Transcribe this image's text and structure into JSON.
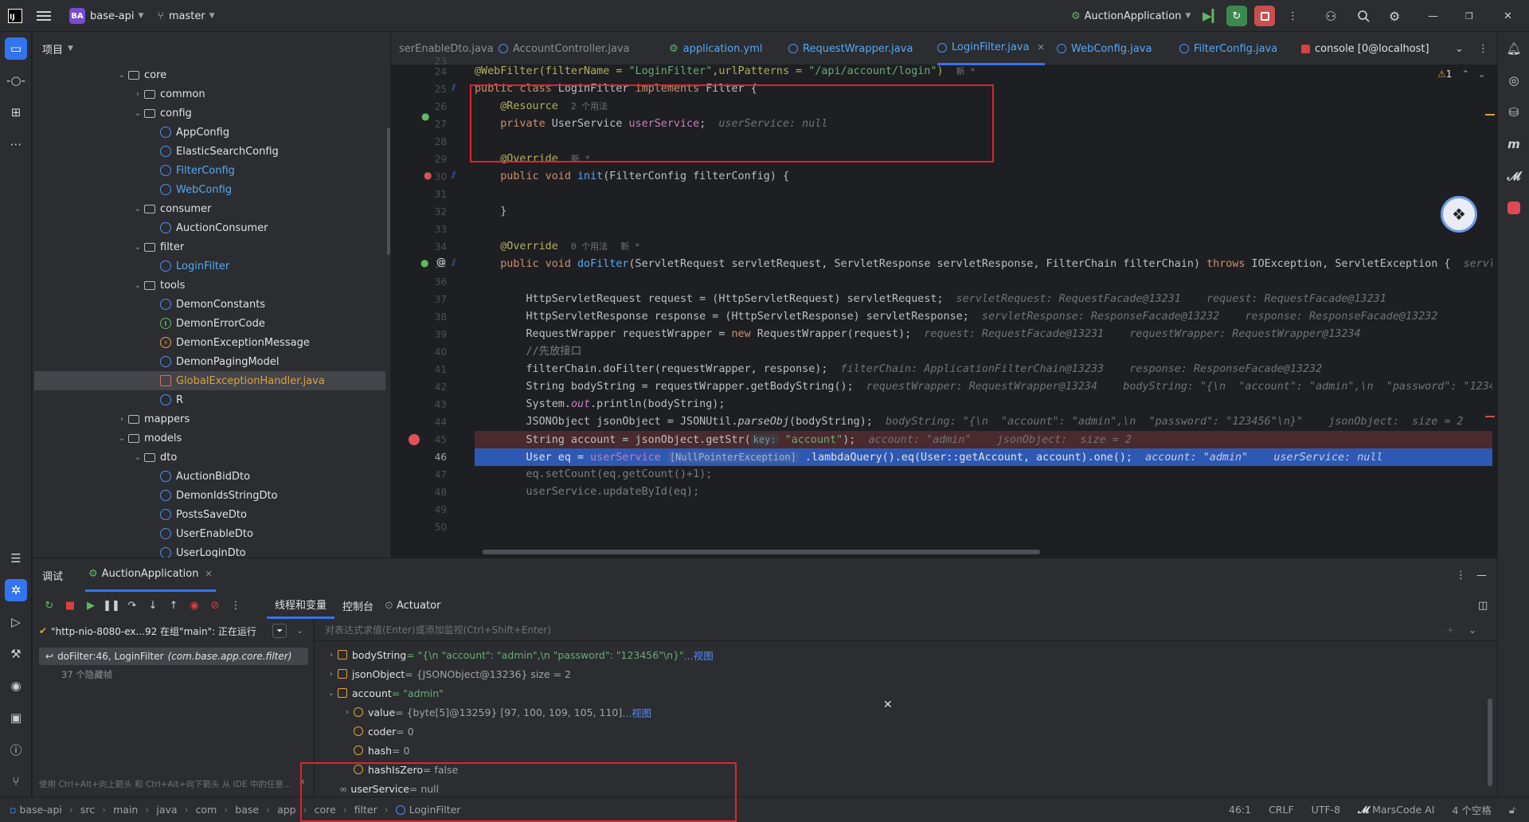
{
  "titlebar": {
    "project_badge": "BA",
    "project_name": "base-api",
    "branch": "master",
    "run_config": "AuctionApplication"
  },
  "project_panel": {
    "title": "项目",
    "tree": [
      {
        "label": "core",
        "type": "folder",
        "expanded": true
      },
      {
        "label": "common",
        "type": "folder",
        "expanded": false
      },
      {
        "label": "config",
        "type": "folder",
        "expanded": true
      },
      {
        "label": "AppConfig",
        "type": "class"
      },
      {
        "label": "ElasticSearchConfig",
        "type": "class"
      },
      {
        "label": "FilterConfig",
        "type": "class",
        "color": "#56a8f5"
      },
      {
        "label": "WebConfig",
        "type": "class",
        "color": "#56a8f5"
      },
      {
        "label": "consumer",
        "type": "folder",
        "expanded": true
      },
      {
        "label": "AuctionConsumer",
        "type": "class"
      },
      {
        "label": "filter",
        "type": "folder",
        "expanded": true
      },
      {
        "label": "LoginFilter",
        "type": "class",
        "color": "#56a8f5"
      },
      {
        "label": "tools",
        "type": "folder",
        "expanded": true
      },
      {
        "label": "DemonConstants",
        "type": "class"
      },
      {
        "label": "DemonErrorCode",
        "type": "interface"
      },
      {
        "label": "DemonExceptionMessage",
        "type": "exception"
      },
      {
        "label": "DemonPagingModel",
        "type": "class"
      },
      {
        "label": "GlobalExceptionHandler.java",
        "type": "javafile",
        "color": "#d9a343"
      },
      {
        "label": "R",
        "type": "class"
      },
      {
        "label": "mappers",
        "type": "folder",
        "expanded": false
      },
      {
        "label": "models",
        "type": "folder",
        "expanded": true
      },
      {
        "label": "dto",
        "type": "folder",
        "expanded": true
      },
      {
        "label": "AuctionBidDto",
        "type": "class"
      },
      {
        "label": "DemonIdsStringDto",
        "type": "class"
      },
      {
        "label": "PostsSaveDto",
        "type": "class"
      },
      {
        "label": "UserEnableDto",
        "type": "class"
      },
      {
        "label": "UserLoginDto",
        "type": "class"
      }
    ]
  },
  "editor_tabs": [
    {
      "label": "serEnableDto.java"
    },
    {
      "label": "AccountController.java"
    },
    {
      "label": "application.yml"
    },
    {
      "label": "RequestWrapper.java"
    },
    {
      "label": "LoginFilter.java",
      "active": true
    },
    {
      "label": "WebConfig.java"
    },
    {
      "label": "FilterConfig.java"
    },
    {
      "label": "console [0@localhost]"
    }
  ],
  "editor": {
    "warning_count": "1",
    "line_numbers": [
      "23",
      "24",
      "25",
      "26",
      "27",
      "28",
      "29",
      "30",
      "31",
      "32",
      "33",
      "34",
      "35",
      "36",
      "37",
      "38",
      "39",
      "40",
      "41",
      "42",
      "43",
      "44",
      "45",
      "46",
      "47",
      "48",
      "49",
      "50"
    ],
    "current_line": "46",
    "breakpoint_line": "45",
    "text": {
      "l24_a": "@WebFilter(filterName = ",
      "l24_s1": "\"LoginFilter\"",
      "l24_b": ",urlPatterns = ",
      "l24_s2": "\"/api/account/login\"",
      "l24_c": ")",
      "l24_new": "新 *",
      "l25_kw1": "public class",
      "l25_name": " LoginFilter ",
      "l25_kw2": "implements",
      "l25_rest": " Filter {",
      "l26_ann": "@Resource",
      "l26_usage": "2 个用法",
      "l27_kw": "private",
      "l27_type": " UserService ",
      "l27_field": "userService",
      "l27_semi": ";",
      "l27_hint": "userService: null",
      "l29_ann": "@Override",
      "l29_new": "新 *",
      "l30_kw": "public void",
      "l30_fn": " init",
      "l30_rest": "(FilterConfig filterConfig) {",
      "l32": "}",
      "l34_ann": "@Override",
      "l34_usage": "0 个用法",
      "l34_new": "新 *",
      "l35_kw": "public void",
      "l35_fn": " doFilter",
      "l35_a": "(ServletRequest servletRequest, ServletResponse servletResponse, FilterChain filterChain) ",
      "l35_throws": "throws",
      "l35_b": " IOException, ServletException {",
      "l35_hint": "servl",
      "l37_code": "HttpServletRequest request = (HttpServletRequest) servletRequest;",
      "l37_hint": "servletRequest: RequestFacade@13231    request: RequestFacade@13231",
      "l38_code": "HttpServletResponse response = (HttpServletResponse) servletResponse;",
      "l38_hint": "servletResponse: ResponseFacade@13232    response: ResponseFacade@13232",
      "l39_a": "RequestWrapper requestWrapper = ",
      "l39_new": "new",
      "l39_b": " RequestWrapper(request);",
      "l39_hint": "request: RequestFacade@13231    requestWrapper: RequestWrapper@13234",
      "l40": "//先放接口",
      "l41_code": "filterChain.doFilter(requestWrapper, response);",
      "l41_hint": "filterChain: ApplicationFilterChain@13233    response: ResponseFacade@13232",
      "l42_code": "String bodyString = requestWrapper.getBodyString();",
      "l42_hint": "requestWrapper: RequestWrapper@13234    bodyString: \"{\\n  \"account\": \"admin\",\\n  \"password\": \"1234",
      "l43_a": "System.",
      "l43_out": "out",
      "l43_b": ".println(bodyString);",
      "l44_a": "JSONObject jsonObject = JSONUtil.",
      "l44_fn": "parseObj",
      "l44_b": "(bodyString);",
      "l44_hint": "bodyString: \"{\\n  \"account\": \"admin\",\\n  \"password\": \"123456\"\\n}\"    jsonObject:  size = 2",
      "l45_a": "String account = jsonObject.getStr(",
      "l45_key": "key:",
      "l45_s": " \"account\"",
      "l45_b": ");",
      "l45_hint": "account: \"admin\"    jsonObject:  size = 2",
      "l46_a": "User eq = ",
      "l46_field": "userService",
      "l46_npe": "[NullPointerException]",
      "l46_b": ".lambdaQuery().eq(User::getAccount, account).one();",
      "l46_hint": "account: \"admin\"    userService: null",
      "l47": "eq.setCount(eq.getCount()+1);",
      "l48": "userService.updateById(eq);"
    }
  },
  "debug_panel": {
    "title": "调试",
    "session_tab": "AuctionApplication",
    "subtabs": [
      "线程和变量",
      "控制台",
      "Actuator"
    ],
    "thread_label": "\"http-nio-8080-ex...92 在组\"main\": 正在运行",
    "frame": "doFilter:46, LoginFilter",
    "frame_pkg": "(com.base.app.core.filter)",
    "hidden_frames": "37 个隐藏帧",
    "tip": "使用 Ctrl+Alt+向上箭头 和 Ctrl+Alt+向下箭头 从 IDE 中的任意...",
    "eval_placeholder": "对表达式求值(Enter)或添加监视(Ctrl+Shift+Enter)",
    "variables": [
      {
        "name": "bodyString",
        "value": " = \"{\\n  \"account\": \"admin\",\\n  \"password\": \"123456\"\\n}\"",
        "link": " ...视图"
      },
      {
        "name": "jsonObject",
        "value": " = {JSONObject@13236}  size = 2",
        "link": ""
      },
      {
        "name": "account",
        "value": " = \"admin\"",
        "link": ""
      },
      {
        "name": "value",
        "value": " = {byte[5]@13259} [97, 100, 109, 105, 110]",
        "link": " ...视图"
      },
      {
        "name": "coder",
        "value": " = 0",
        "link": ""
      },
      {
        "name": "hash",
        "value": " = 0",
        "link": ""
      },
      {
        "name": "hashIsZero",
        "value": " = false",
        "link": ""
      },
      {
        "name": "userService",
        "value": " = null",
        "link": ""
      }
    ]
  },
  "statusbar": {
    "breadcrumb": [
      "base-api",
      "src",
      "main",
      "java",
      "com",
      "base",
      "app",
      "core",
      "filter",
      "LoginFilter"
    ],
    "position": "46:1",
    "line_sep": "CRLF",
    "encoding": "UTF-8",
    "ai": "MarsCode AI",
    "indent": "4 个空格"
  }
}
